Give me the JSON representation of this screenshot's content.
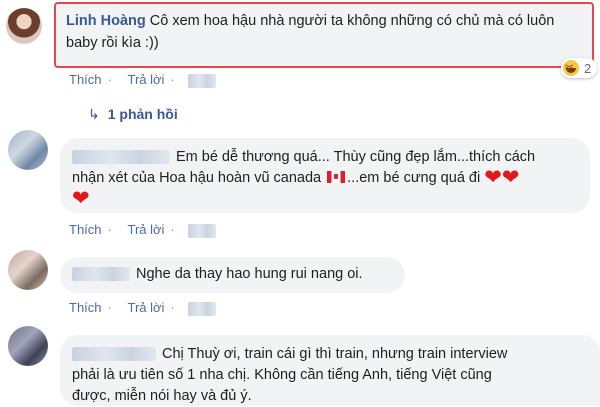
{
  "comments": [
    {
      "author": "Linh Hoàng",
      "text": "Cô xem hoa hậu nhà người ta không những có chủ mà có luôn baby rồi kìa :))",
      "reaction_count": "2",
      "reaction_icon": "laughing-face-icon"
    },
    {
      "text_line1": "Em bé dễ thương quá... Thùy cũng đẹp lắm...thích cách",
      "text_line2a": "nhận xét của Hoa hậu hoàn vũ canada",
      "text_line2b": "...em bé cưng quá đi",
      "emoji": "canada-flag-icon"
    },
    {
      "text": "Nghe da thay hao hung rui nang oi."
    },
    {
      "text_line1": "Chị Thuỳ ơi, train cái gì thì train, nhưng train interview",
      "text_line2": "phải là ưu tiên số 1 nha chị. Không cần tiếng Anh, tiếng Việt cũng",
      "text_line3": "được, miễn nói hay và đủ ý."
    }
  ],
  "actions": {
    "like": "Thích",
    "reply": "Trả lời",
    "separator": "·"
  },
  "replies_link": "1 phản hồi",
  "colors": {
    "link": "#385898",
    "bubble": "#f2f3f5",
    "highlight_border": "#e0484f",
    "heart": "#e0181b"
  }
}
